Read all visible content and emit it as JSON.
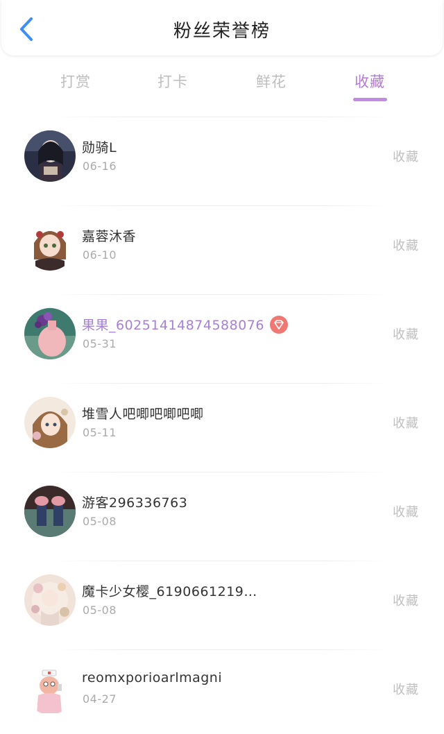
{
  "header": {
    "title": "粉丝荣誉榜",
    "back_icon": "chevron-left-icon",
    "accent_color": "#3d8ef7"
  },
  "tabs": [
    {
      "label": "打赏",
      "active": false
    },
    {
      "label": "打卡",
      "active": false
    },
    {
      "label": "鲜花",
      "active": false
    },
    {
      "label": "收藏",
      "active": true
    }
  ],
  "active_tab_color": "#b37ad6",
  "list": [
    {
      "name": "勋骑L",
      "date": "06-16",
      "action": "收藏",
      "vip": false
    },
    {
      "name": "嘉蓉沐香",
      "date": "06-10",
      "action": "收藏",
      "vip": false
    },
    {
      "name": "果果_60251414874588076",
      "date": "05-31",
      "action": "收藏",
      "vip": true,
      "badge_icon": "diamond-icon"
    },
    {
      "name": "堆雪人吧唧吧唧吧唧",
      "date": "05-11",
      "action": "收藏",
      "vip": false
    },
    {
      "name": "游客296336763",
      "date": "05-08",
      "action": "收藏",
      "vip": false
    },
    {
      "name": "魔卡少女樱_6190661219…",
      "date": "05-08",
      "action": "收藏",
      "vip": false
    },
    {
      "name": "reomxporioarlmagni",
      "date": "04-27",
      "action": "收藏",
      "vip": false
    }
  ]
}
